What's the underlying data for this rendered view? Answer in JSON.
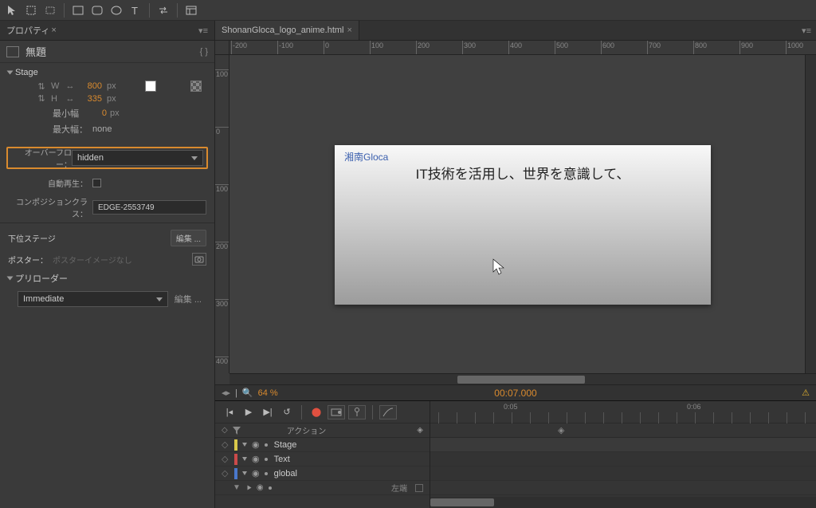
{
  "toolbar": {
    "dummy": ""
  },
  "leftPanel": {
    "tab": "プロパティ",
    "docTitle": "無題",
    "conv": "{ }",
    "stageLabel": "Stage",
    "w": {
      "label": "W",
      "link": "⇅",
      "value": "800",
      "unit": "px"
    },
    "h": {
      "label": "H",
      "link": "⇅",
      "value": "335",
      "unit": "px"
    },
    "minW": {
      "label": "最小幅",
      "value": "0",
      "unit": "px"
    },
    "maxW": {
      "label": "最大幅：",
      "value": "none"
    },
    "overflow": {
      "label": "オーバーフロー：",
      "value": "hidden"
    },
    "autoplay": {
      "label": "自動再生："
    },
    "compClass": {
      "label": "コンポジションクラス：",
      "value": "EDGE-2553749"
    },
    "substage": {
      "label": "下位ステージ",
      "edit": "編集 ..."
    },
    "poster": {
      "label": "ポスター：",
      "placeholder": "ポスターイメージなし"
    },
    "preloader": {
      "label": "プリローダー",
      "value": "Immediate",
      "edit": "編集 ..."
    }
  },
  "doc": {
    "tab": "ShonanGloca_logo_anime.html",
    "logo": "湘南Gloca",
    "headline": "IT技術を活用し、世界を意識して、"
  },
  "ruler_h": [
    "-200",
    "-100",
    "0",
    "100",
    "200",
    "300",
    "400",
    "500",
    "600",
    "700",
    "800",
    "900",
    "1000"
  ],
  "ruler_v": [
    "100",
    "0",
    "100",
    "200",
    "300",
    "400"
  ],
  "zoom": {
    "pct": "64 %",
    "time": "00:07.000"
  },
  "timeline": {
    "actions": "アクション",
    "ticks": [
      "0:05",
      "0:06"
    ],
    "layers": [
      {
        "color": "cb-yellow",
        "name": "Stage"
      },
      {
        "color": "cb-red",
        "name": "Text"
      },
      {
        "color": "cb-blue",
        "name": "global"
      }
    ],
    "rightSmall": "左端"
  }
}
